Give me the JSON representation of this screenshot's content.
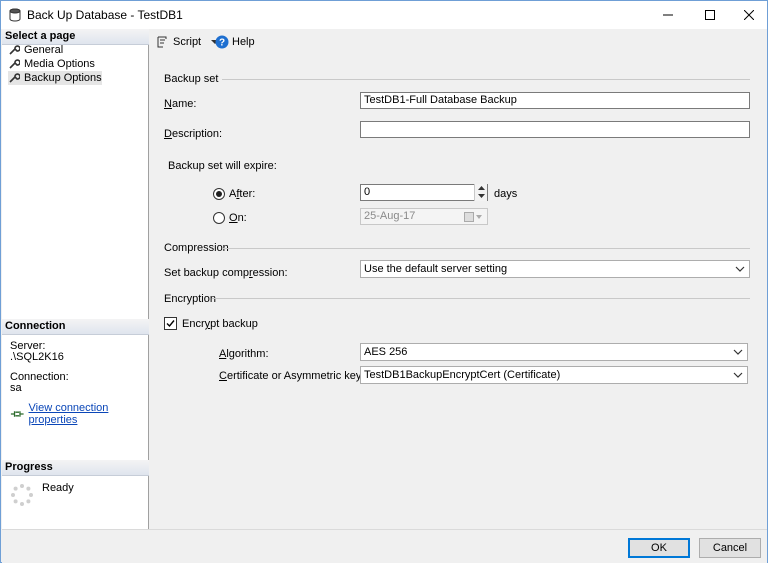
{
  "window": {
    "title": "Back Up Database - TestDB1"
  },
  "left": {
    "select_page_header": "Select a page",
    "pages": [
      {
        "label": "General",
        "icon": "wrench-icon"
      },
      {
        "label": "Media Options",
        "icon": "wrench-icon"
      },
      {
        "label": "Backup Options",
        "icon": "wrench-icon",
        "selected": true
      }
    ],
    "connection_header": "Connection",
    "server_label": "Server:",
    "server_value": ".\\SQL2K16",
    "connection_label": "Connection:",
    "connection_value": "sa",
    "view_connection_link": "View connection properties",
    "progress_header": "Progress",
    "progress_status": "Ready"
  },
  "toolbar": {
    "script_label": "Script",
    "help_label": "Help"
  },
  "backup_set": {
    "header": "Backup set",
    "name_label": "Name:",
    "name_value": "TestDB1-Full Database Backup",
    "description_label": "Description:",
    "description_value": "",
    "expire_label": "Backup set will expire:",
    "after_label": "After:",
    "after_value": "0",
    "days_label": "days",
    "on_label": "On:",
    "on_value": "25-Aug-17",
    "expire_mode": "after"
  },
  "compression": {
    "header": "Compression",
    "label": "Set backup compression:",
    "selected": "Use the default server setting"
  },
  "encryption": {
    "header": "Encryption",
    "encrypt_label": "Encrypt backup",
    "encrypt_checked": true,
    "algorithm_label": "Algorithm:",
    "algorithm_value": "AES 256",
    "cert_label": "Certificate or Asymmetric key:",
    "cert_value": "TestDB1BackupEncryptCert (Certificate)"
  },
  "buttons": {
    "ok": "OK",
    "cancel": "Cancel"
  },
  "colors": {
    "accent": "#0078d7",
    "link": "#0a46b8",
    "help_icon": "#1e6fd0"
  }
}
